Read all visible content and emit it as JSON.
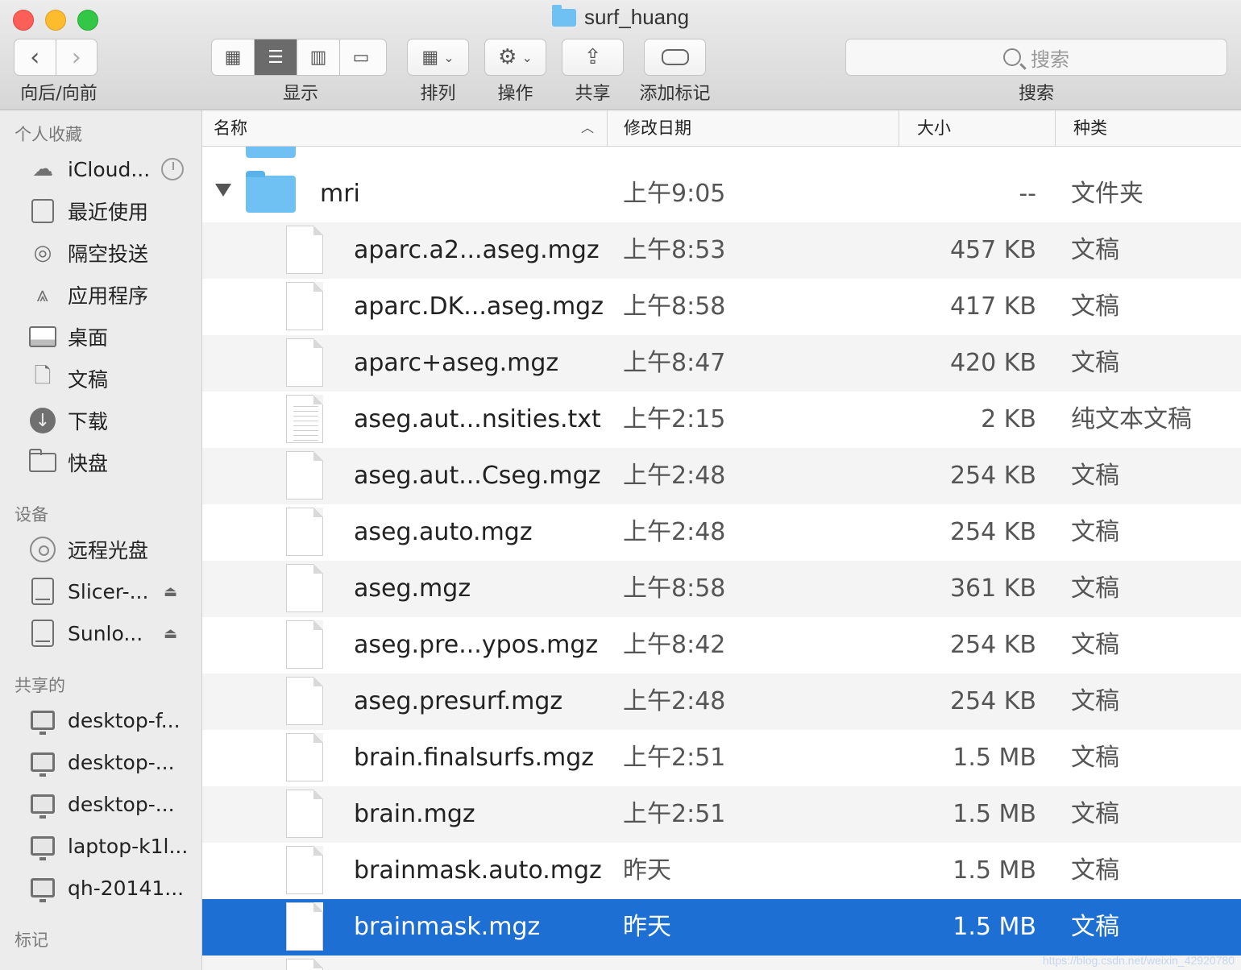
{
  "window": {
    "title": "surf_huang"
  },
  "toolbar": {
    "nav_label": "向后/向前",
    "view_label": "显示",
    "arrange_label": "排列",
    "action_label": "操作",
    "share_label": "共享",
    "tags_label": "添加标记",
    "search_placeholder": "搜索",
    "search_label": "搜索"
  },
  "sidebar": {
    "favorites_title": "个人收藏",
    "favorites": [
      {
        "label": "iCloud...",
        "icon": "cloud-icon"
      },
      {
        "label": "最近使用",
        "icon": "recents-icon"
      },
      {
        "label": "隔空投送",
        "icon": "airdrop-icon"
      },
      {
        "label": "应用程序",
        "icon": "applications-icon"
      },
      {
        "label": "桌面",
        "icon": "desktop-icon"
      },
      {
        "label": "文稿",
        "icon": "documents-icon"
      },
      {
        "label": "下载",
        "icon": "downloads-icon"
      },
      {
        "label": "快盘",
        "icon": "folder-icon"
      }
    ],
    "devices_title": "设备",
    "devices": [
      {
        "label": "远程光盘",
        "icon": "cd-icon"
      },
      {
        "label": "Slicer-...",
        "icon": "disk-icon"
      },
      {
        "label": "Sunlo...",
        "icon": "disk-icon"
      }
    ],
    "shared_title": "共享的",
    "shared": [
      {
        "label": "desktop-f...",
        "icon": "monitor-icon"
      },
      {
        "label": "desktop-...",
        "icon": "monitor-icon"
      },
      {
        "label": "desktop-...",
        "icon": "monitor-icon"
      },
      {
        "label": "laptop-k1l...",
        "icon": "monitor-icon"
      },
      {
        "label": "qh-20141...",
        "icon": "monitor-icon"
      }
    ],
    "tags_title": "标记"
  },
  "columns": {
    "name": "名称",
    "date": "修改日期",
    "size": "大小",
    "kind": "种类"
  },
  "folder": {
    "name": "mri",
    "date": "上午9:05",
    "size": "--",
    "kind": "文件夹"
  },
  "files": [
    {
      "name": "aparc.a2...aseg.mgz",
      "date": "上午8:53",
      "size": "457 KB",
      "kind": "文稿"
    },
    {
      "name": "aparc.DK...aseg.mgz",
      "date": "上午8:58",
      "size": "417 KB",
      "kind": "文稿"
    },
    {
      "name": "aparc+aseg.mgz",
      "date": "上午8:47",
      "size": "420 KB",
      "kind": "文稿"
    },
    {
      "name": "aseg.aut...nsities.txt",
      "date": "上午2:15",
      "size": "2 KB",
      "kind": "纯文本文稿"
    },
    {
      "name": "aseg.aut...Cseg.mgz",
      "date": "上午2:48",
      "size": "254 KB",
      "kind": "文稿"
    },
    {
      "name": "aseg.auto.mgz",
      "date": "上午2:48",
      "size": "254 KB",
      "kind": "文稿"
    },
    {
      "name": "aseg.mgz",
      "date": "上午8:58",
      "size": "361 KB",
      "kind": "文稿"
    },
    {
      "name": "aseg.pre...ypos.mgz",
      "date": "上午8:42",
      "size": "254 KB",
      "kind": "文稿"
    },
    {
      "name": "aseg.presurf.mgz",
      "date": "上午2:48",
      "size": "254 KB",
      "kind": "文稿"
    },
    {
      "name": "brain.finalsurfs.mgz",
      "date": "上午2:51",
      "size": "1.5 MB",
      "kind": "文稿"
    },
    {
      "name": "brain.mgz",
      "date": "上午2:51",
      "size": "1.5 MB",
      "kind": "文稿"
    },
    {
      "name": "brainmask.auto.mgz",
      "date": "昨天",
      "size": "1.5 MB",
      "kind": "文稿"
    },
    {
      "name": "brainmask.mgz",
      "date": "昨天",
      "size": "1.5 MB",
      "kind": "文稿",
      "selected": true
    }
  ],
  "watermark": "https://blog.csdn.net/weixin_42920780",
  "colors": {
    "selection": "#1e6fd4",
    "folder": "#6ec1f2"
  }
}
